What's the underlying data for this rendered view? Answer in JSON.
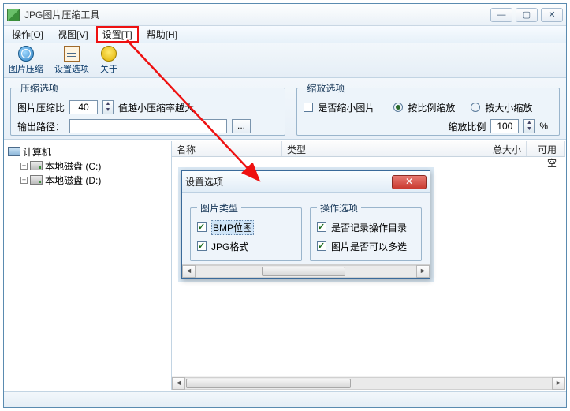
{
  "title": "JPG图片压缩工具",
  "menu": {
    "op": "操作[O]",
    "view": "视图[V]",
    "settings": "设置[T]",
    "help": "帮助[H]"
  },
  "toolbar": {
    "compress": "图片压缩",
    "options": "设置选项",
    "about": "关于"
  },
  "compress_group": {
    "legend": "压缩选项",
    "ratio_label": "图片压缩比",
    "ratio_value": "40",
    "hint": "值越小压缩率越大",
    "out_label": "输出路径：",
    "dots": "..."
  },
  "scale_group": {
    "legend": "缩放选项",
    "shrink": "是否缩小图片",
    "by_ratio": "按比例缩放",
    "by_size": "按大小缩放",
    "ratio_label": "缩放比例",
    "ratio_value": "100",
    "pct": "%"
  },
  "tree": {
    "computer": "计算机",
    "c": "本地磁盘 (C:)",
    "d": "本地磁盘 (D:)",
    "plus": "+"
  },
  "cols": {
    "name": "名称",
    "type": "类型",
    "size": "总大小",
    "free": "可用空"
  },
  "dialog": {
    "title": "设置选项",
    "g1": "图片类型",
    "bmp": "BMP位图",
    "jpg": "JPG格式",
    "g2": "操作选项",
    "remember": "是否记录操作目录",
    "multi": "图片是否可以多选"
  },
  "winbtns": {
    "min": "—",
    "max": "▢",
    "close": "✕"
  }
}
